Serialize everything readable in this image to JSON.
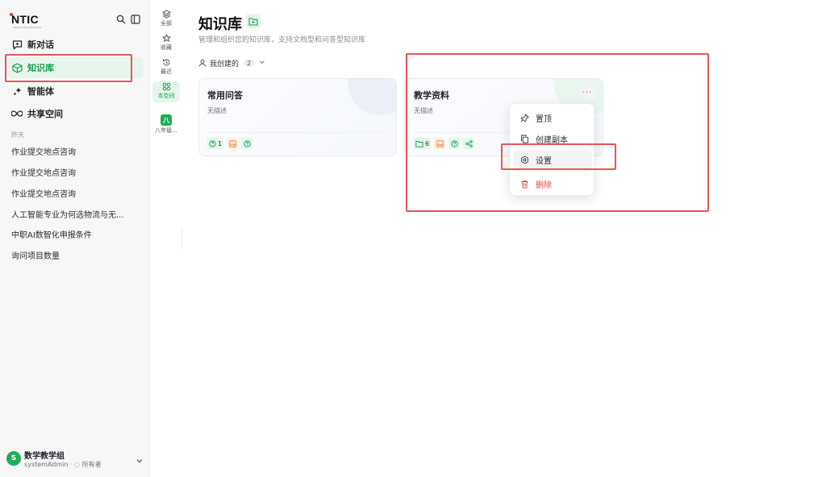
{
  "sidebar": {
    "logo_text": "NTIC",
    "logo_subtext": "Please Survey Business",
    "nav": [
      {
        "label": "新对话",
        "icon": "message-plus-icon"
      },
      {
        "label": "知识库",
        "icon": "knowledge-cube-icon",
        "active": true
      },
      {
        "label": "智能体",
        "icon": "sparkle-icon"
      },
      {
        "label": "共享空间",
        "icon": "infinity-icon"
      }
    ],
    "history_label": "昨天",
    "history": [
      "作业提交地点咨询",
      "作业提交地点咨询",
      "作业提交地点咨询",
      "人工智能专业为何选物流与无...",
      "中职AI数智化申报条件",
      "询问项目数量"
    ],
    "user": {
      "avatar_letter": "S",
      "name": "数学教学组",
      "role_line": "systemAdmin · ◌ 所有者"
    }
  },
  "rail": {
    "items": [
      {
        "label": "全部",
        "icon": "layers-icon"
      },
      {
        "label": "收藏",
        "icon": "star-icon"
      },
      {
        "label": "最近",
        "icon": "history-icon"
      },
      {
        "label": "本空间",
        "icon": "grid-icon",
        "active": true
      },
      {
        "label": "八年级...",
        "badge": "八"
      }
    ]
  },
  "main": {
    "title": "知识库",
    "subtitle": "管理和组织您的知识库，支持文档型和问答型知识库",
    "filter": {
      "label": "我创建的",
      "count": "2"
    },
    "cards": [
      {
        "title": "常用问答",
        "desc": "无描述",
        "tags": [
          {
            "icon": "question-icon",
            "value": "1",
            "color": "green"
          },
          {
            "icon": "image-icon",
            "value": "",
            "color": "orange"
          },
          {
            "icon": "help-circle-icon",
            "value": "",
            "color": "green"
          }
        ]
      },
      {
        "title": "教学资料",
        "desc": "无描述",
        "more": "···",
        "tags": [
          {
            "icon": "folder-icon",
            "value": "6",
            "color": "green"
          },
          {
            "icon": "image-icon",
            "value": "",
            "color": "orange"
          },
          {
            "icon": "help-circle-icon",
            "value": "",
            "color": "green"
          },
          {
            "icon": "share-icon",
            "value": "",
            "color": "green"
          }
        ]
      }
    ]
  },
  "menu": {
    "items": [
      {
        "label": "置顶",
        "icon": "pin-icon"
      },
      {
        "label": "创建副本",
        "icon": "copy-icon"
      },
      {
        "label": "设置",
        "icon": "settings-icon",
        "hover": true
      },
      {
        "label": "删除",
        "icon": "trash-icon",
        "danger": true
      }
    ]
  },
  "colors": {
    "accent": "#1a9e4b",
    "annotation": "#e8555a",
    "danger": "#e34a4a"
  }
}
